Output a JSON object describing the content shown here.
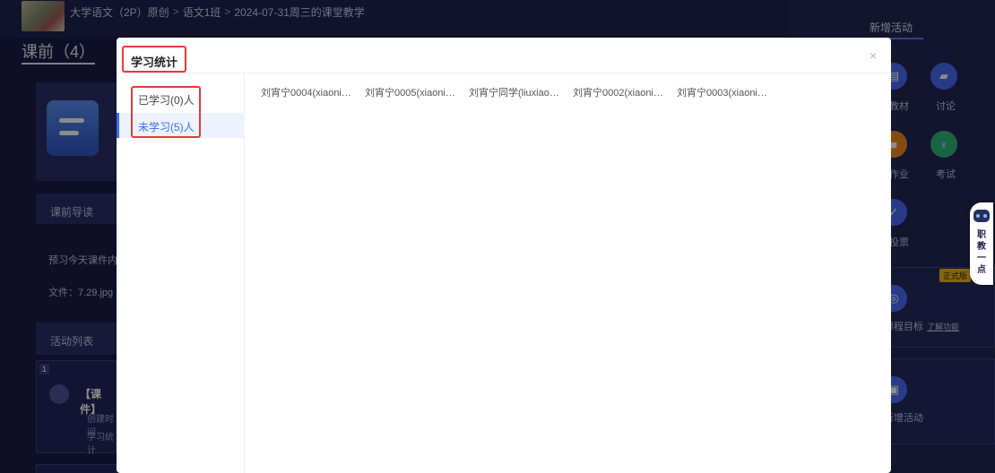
{
  "breadcrumb": {
    "course": "大学语文（2P）原创",
    "class": "语文1班",
    "lesson": "2024-07-31周三的课堂教学",
    "separator": ">"
  },
  "section": {
    "title": "课前（4）"
  },
  "background": {
    "guide_label": "课前导读",
    "guide_text": "预习今天课件内容",
    "file_text": "文件：7.29.jpg",
    "activity_list_label": "活动列表",
    "activity": {
      "index": "1",
      "type_label": "【课件】",
      "created_prefix": "创建时间",
      "stats_prefix": "学习统计"
    }
  },
  "right_panel": {
    "title": "新增活动",
    "items": [
      {
        "label": "教材",
        "icon": "book-icon"
      },
      {
        "label": "讨论",
        "icon": "chat-icon"
      },
      {
        "label": "作业",
        "icon": "homework-icon"
      },
      {
        "label": "考试",
        "icon": "exam-icon"
      },
      {
        "label": "投票",
        "icon": "vote-icon"
      },
      {
        "label": "课程目标",
        "icon": "target-icon"
      },
      {
        "label": "新增活动",
        "icon": "activity-icon"
      }
    ],
    "badge": "正式版",
    "learn_more": "了解功能",
    "colors": {
      "blue": "#4a6cf7",
      "orange": "#f28a1f",
      "green": "#2fb67a"
    }
  },
  "assistant": {
    "text": "职教一点"
  },
  "modal": {
    "title": "学习统计",
    "close": "×",
    "tabs": [
      {
        "label": "已学习(0)人",
        "active": false
      },
      {
        "label": "未学习(5)人",
        "active": true
      }
    ],
    "students": [
      "刘宵宁0004(xiaoning…",
      "刘宵宁0005(xiaoning…",
      "刘宵宁同学(liuxiaonin…",
      "刘宵宁0002(xiaoning…",
      "刘宵宁0003(xiaoning…"
    ],
    "accent": "#3a6ff5",
    "highlight": "#e53b3b"
  }
}
